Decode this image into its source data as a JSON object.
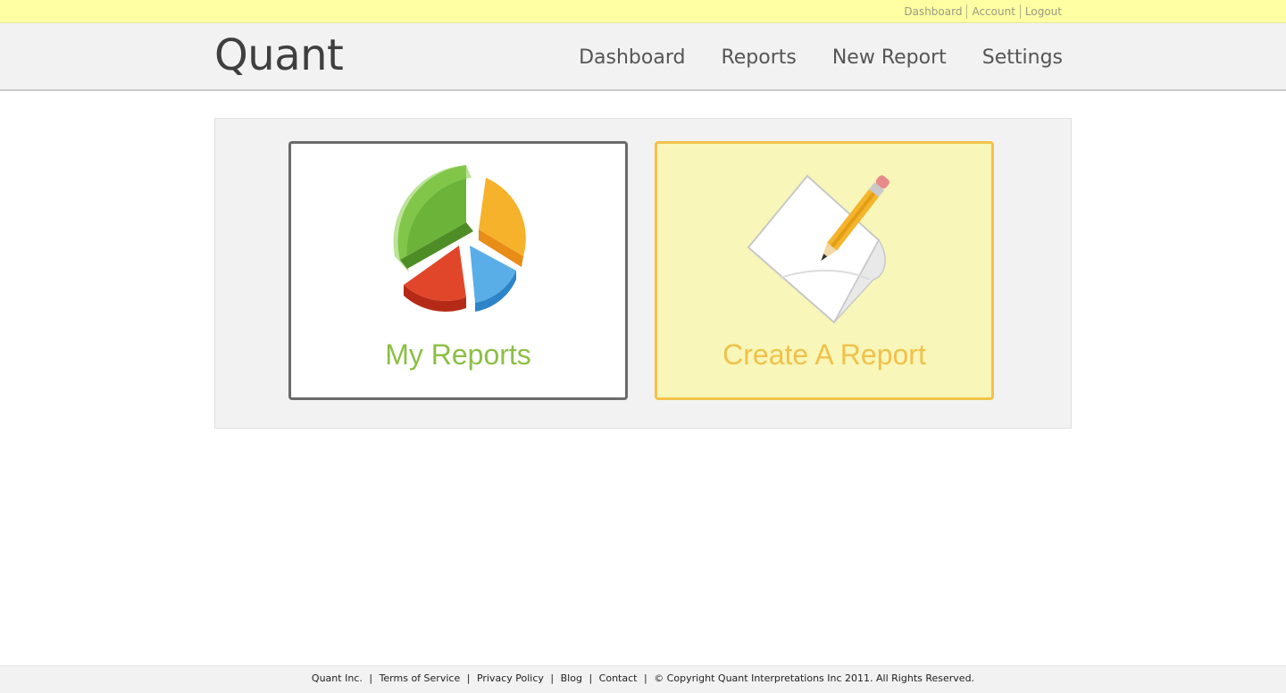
{
  "top_links": [
    "Dashboard",
    "Account",
    "Logout"
  ],
  "header": {
    "logo": "Quant",
    "nav": [
      "Dashboard",
      "Reports",
      "New Report",
      "Settings"
    ]
  },
  "cards": {
    "reports": {
      "label": "My Reports",
      "icon": "pie-chart-icon"
    },
    "create": {
      "label": "Create A Report",
      "icon": "paper-pencil-icon"
    }
  },
  "footer": {
    "company": "Quant Inc.",
    "terms": "Terms of Service",
    "privacy": "Privacy Policy",
    "blog": "Blog",
    "contact": "Contact",
    "copyright": "© Copyright Quant Interpretations Inc 2011. All Rights Reserved."
  },
  "colors": {
    "topbar": "#ffffa4",
    "reports_label": "#8cbf44",
    "create_label": "#f0c14a",
    "create_bg": "#f8f6b8"
  }
}
